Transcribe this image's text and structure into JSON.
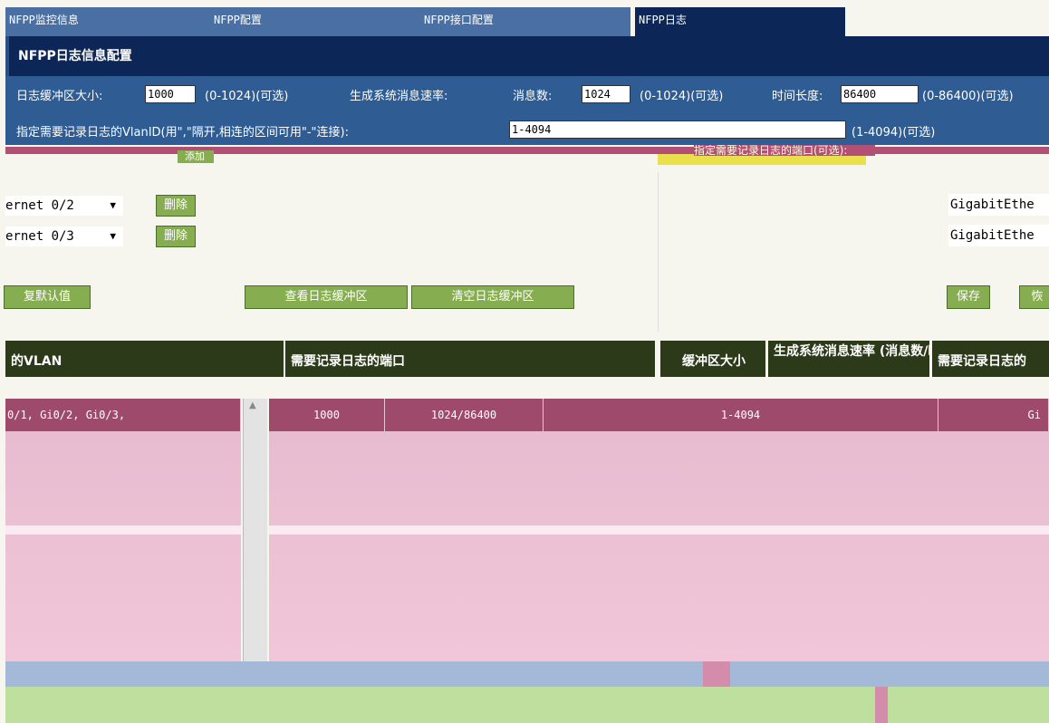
{
  "tabs": [
    {
      "label": "NFPP监控信息"
    },
    {
      "label": "NFPP配置"
    },
    {
      "label": "NFPP接口配置"
    },
    {
      "label": "NFPP日志"
    }
  ],
  "panel_title": "NFPP日志信息配置",
  "buffer": {
    "label": "日志缓冲区大小:",
    "value": "1000",
    "range": "(0-1024)(可选)"
  },
  "rate": {
    "label": "生成系统消息速率:",
    "count_label": "消息数:",
    "count_value": "1024",
    "count_range": "(0-1024)(可选)",
    "time_label": "时间长度:",
    "time_value": "86400",
    "time_range": "(0-86400)(可选)"
  },
  "vlan": {
    "label": "指定需要记录日志的VlanID(用\",\"隔开,相连的区间可用\"-\"连接):",
    "value": "1-4094",
    "range": "(1-4094)(可选)"
  },
  "glitch": {
    "add_label": "添加",
    "right_label": "指定需要记录日志的端口(可选):"
  },
  "ports": [
    {
      "value": "ernet 0/2",
      "delete_label": "删除"
    },
    {
      "value": "ernet 0/3",
      "delete_label": "删除"
    }
  ],
  "right_ports": [
    "GigabitEthe",
    "GigabitEthe"
  ],
  "buttons": {
    "restore": "复默认值",
    "view_buffer": "查看日志缓冲区",
    "clear_buffer": "清空日志缓冲区",
    "save": "保存",
    "restore_right": "恢"
  },
  "grid": {
    "headers": [
      "的VLAN",
      "需要记录日志的端口",
      "缓冲区大小",
      "生成系统消息速率 (消息数/时间长度)",
      "需要记录日志的"
    ],
    "row": {
      "ports": "0/1, Gi0/2, Gi0/3,",
      "buffer": "1000",
      "rate": "1024/86400",
      "vlan": "1-4094",
      "tail": "Gi"
    }
  }
}
